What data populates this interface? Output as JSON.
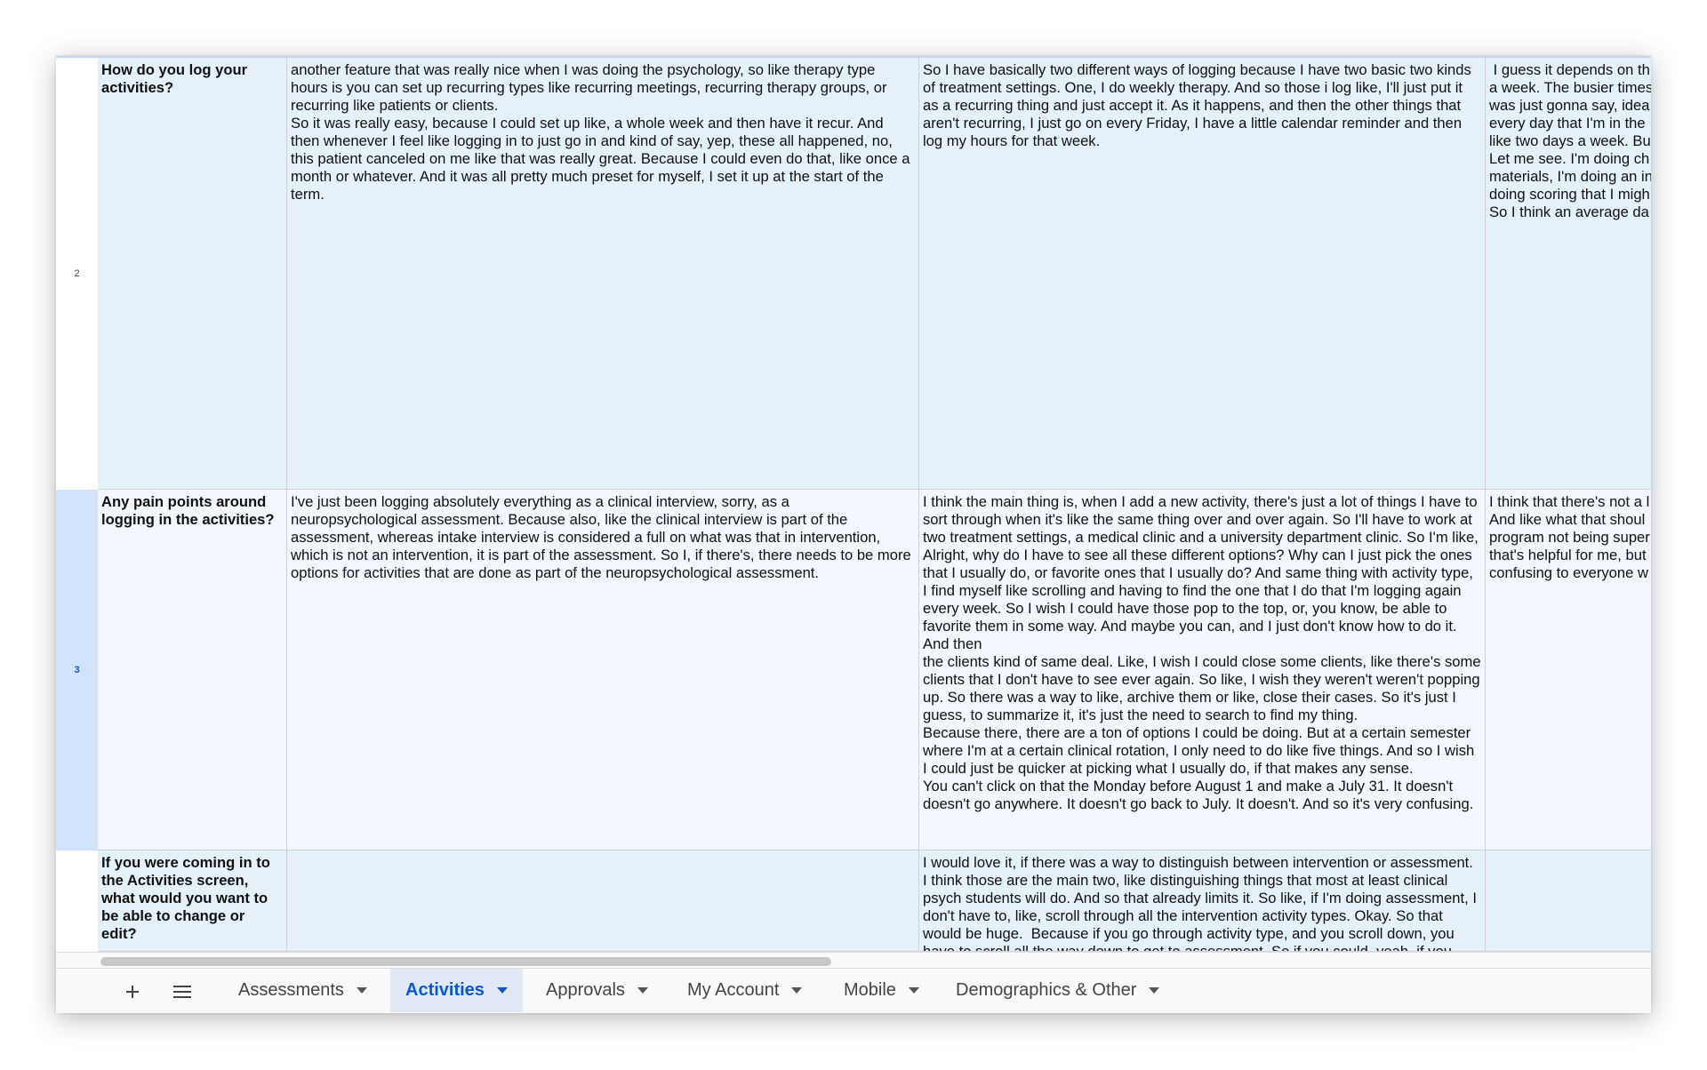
{
  "rows": [
    {
      "number": "2",
      "question": "How do you log your activities?",
      "col_b": "another feature that was really nice when I was doing the psychology, so like therapy type hours is you can set up recurring types like recurring meetings, recurring therapy groups, or recurring like patients or clients.\nSo it was really easy, because I could set up like, a whole week and then have it recur. And then whenever I feel like logging in to just go in and kind of say, yep, these all happened, no, this patient canceled on me like that was really great. Because I could even do that, like once a month or whatever. And it was all pretty much preset for myself, I set it up at the start of the term.",
      "col_c": "So I have basically two different ways of logging because I have two basic two kinds of treatment settings. One, I do weekly therapy. And so those i log like, I'll just put it as a recurring thing and just accept it. As it happens, and then the other things that aren't recurring, I just go on every Friday, I have a little calendar reminder and then log my hours for that week.",
      "col_d": " I guess it depends on th\na week. The busier times\nwas just gonna say, idea\nevery day that I'm in the\nlike two days a week. Bu\nLet me see. I'm doing ch\nmaterials, I'm doing an in\ndoing scoring that I migh\nSo I think an average da"
    },
    {
      "number": "3",
      "question": "Any pain points around logging in the activities?",
      "col_b": "I've just been logging absolutely everything as a clinical interview, sorry, as a neuropsychological assessment. Because also, like the clinical interview is part of the assessment, whereas intake interview is considered a full on what was that in intervention, which is not an intervention, it is part of the assessment. So I, if there's, there needs to be more options for activities that are done as part of the neuropsychological assessment.",
      "col_c": "I think the main thing is, when I add a new activity, there's just a lot of things I have to sort through when it's like the same thing over and over again. So I'll have to work at two treatment settings, a medical clinic and a university department clinic. So I'm like, Alright, why do I have to see all these different options? Why can I just pick the ones that I usually do, or favorite ones that I usually do? And same thing with activity type, I find myself like scrolling and having to find the one that I do that I'm logging again every week. So I wish I could have those pop to the top, or, you know, be able to favorite them in some way. And maybe you can, and I just don't know how to do it. And then\nthe clients kind of same deal. Like, I wish I could close some clients, like there's some clients that I don't have to see ever again. So like, I wish they weren't weren't popping up. So there was a way to like, archive them or like, close their cases. So it's just I guess, to summarize it, it's just the need to search to find my thing.\nBecause there, there are a ton of options I could be doing. But at a certain semester where I'm at a certain clinical rotation, I only need to do like five things. And so I wish I could just be quicker at picking what I usually do, if that makes any sense.\nYou can't click on that the Monday before August 1 and make a July 31. It doesn't doesn't go anywhere. It doesn't go back to July. It doesn't. And so it's very confusing.",
      "col_d": "I think that there's not a l\nAnd like what that shoul\nprogram not being super\nthat's helpful for me, but\nconfusing to everyone w"
    },
    {
      "number": "",
      "question": "If you were coming in to the Activities screen, what would you want to be able to change or edit?",
      "col_b": "",
      "col_c": "I would love it, if there was a way to distinguish between intervention or assessment. I think those are the main two, like distinguishing things that most at least clinical psych students will do. And so that already limits it. So like, if I'm doing assessment, I don't have to, like, scroll through all the intervention activity types. Okay. So that would be huge.  Because if you go through activity type, and you scroll down, you have to scroll all the way down to get to assessment. So if you could, yeah, if you",
      "col_d": ""
    }
  ],
  "toolbar": {
    "add_icon": "plus-icon",
    "menu_icon": "hamburger-icon"
  },
  "tabs": [
    {
      "label": "Assessments",
      "active": false
    },
    {
      "label": "Activities",
      "active": true
    },
    {
      "label": "Approvals",
      "active": false
    },
    {
      "label": "My Account",
      "active": false
    },
    {
      "label": "Mobile",
      "active": false
    },
    {
      "label": "Demographics & Other",
      "active": false
    }
  ],
  "colors": {
    "active_tab_text": "#0b57d0",
    "active_tab_bg": "#e1e9f7",
    "selected_row_header": "#d3e3fd",
    "cell_bg_blue": "#e4f1f9"
  }
}
